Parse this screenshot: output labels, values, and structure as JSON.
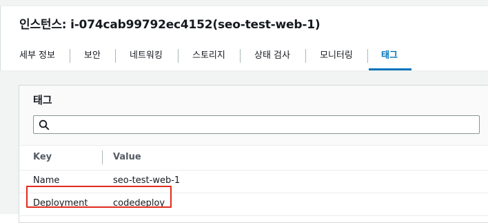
{
  "page": {
    "title": "인스턴스: i-074cab99792ec4152(seo-test-web-1)"
  },
  "tabs": [
    {
      "label": "세부 정보",
      "active": false
    },
    {
      "label": "보안",
      "active": false
    },
    {
      "label": "네트워킹",
      "active": false
    },
    {
      "label": "스토리지",
      "active": false
    },
    {
      "label": "상태 검사",
      "active": false
    },
    {
      "label": "모니터링",
      "active": false
    },
    {
      "label": "태그",
      "active": true
    }
  ],
  "tags_panel": {
    "title": "태그",
    "search": {
      "value": "",
      "placeholder": ""
    },
    "columns": [
      "Key",
      "Value"
    ],
    "rows": [
      {
        "key": "Name",
        "value": "seo-test-web-1",
        "highlighted": false
      },
      {
        "key": "Deployment",
        "value": "codedeploy",
        "highlighted": true
      }
    ]
  },
  "colors": {
    "accent": "#0073bb",
    "highlight": "#e02a1b",
    "text": "#16191f",
    "muted_text": "#545b64",
    "background": "#f2f3f3"
  },
  "icons": {
    "search": "search-icon"
  }
}
